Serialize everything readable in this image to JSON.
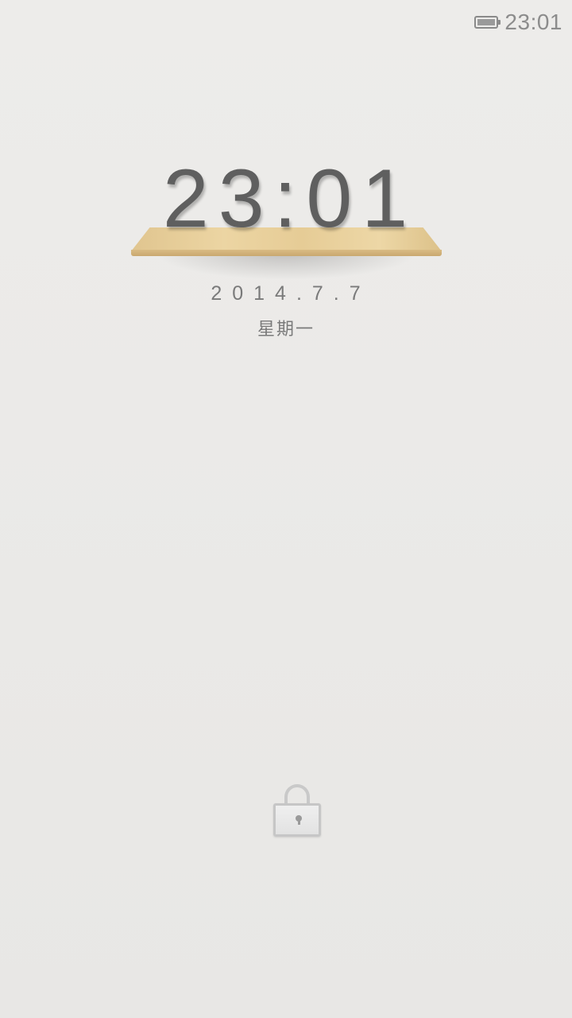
{
  "status_bar": {
    "battery_icon": "battery-full-icon",
    "battery_level": 1.0,
    "time": "23:01"
  },
  "lockscreen": {
    "clock": "23:01",
    "date": "2014.7.7",
    "weekday": "星期一",
    "unlock_icon": "lock-icon"
  },
  "colors": {
    "background": "#ebeae8",
    "text": "#5f5f5f",
    "shelf_wood": "#e6cc96"
  }
}
